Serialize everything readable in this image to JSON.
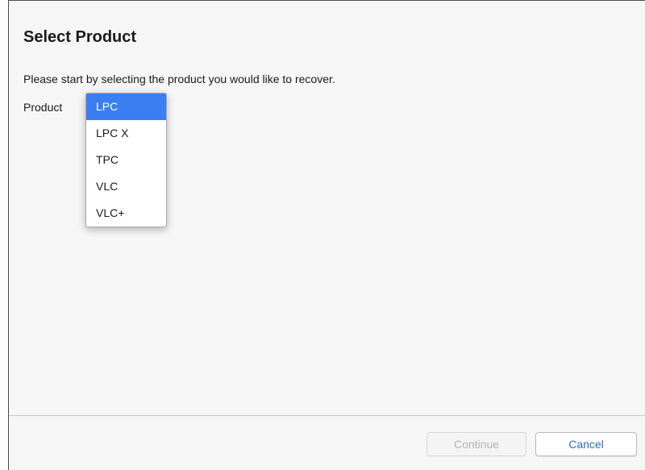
{
  "dialog": {
    "title": "Select Product",
    "instructions": "Please start by selecting the product you would like to recover."
  },
  "product": {
    "label": "Product",
    "selected": "LPC",
    "options": [
      "LPC",
      "LPC X",
      "TPC",
      "VLC",
      "VLC+"
    ]
  },
  "footer": {
    "continue_label": "Continue",
    "continue_enabled": false,
    "cancel_label": "Cancel"
  },
  "colors": {
    "selection": "#3b7ef2",
    "cancel_text": "#2e6bd3",
    "disabled_text": "#b3b3b3"
  }
}
